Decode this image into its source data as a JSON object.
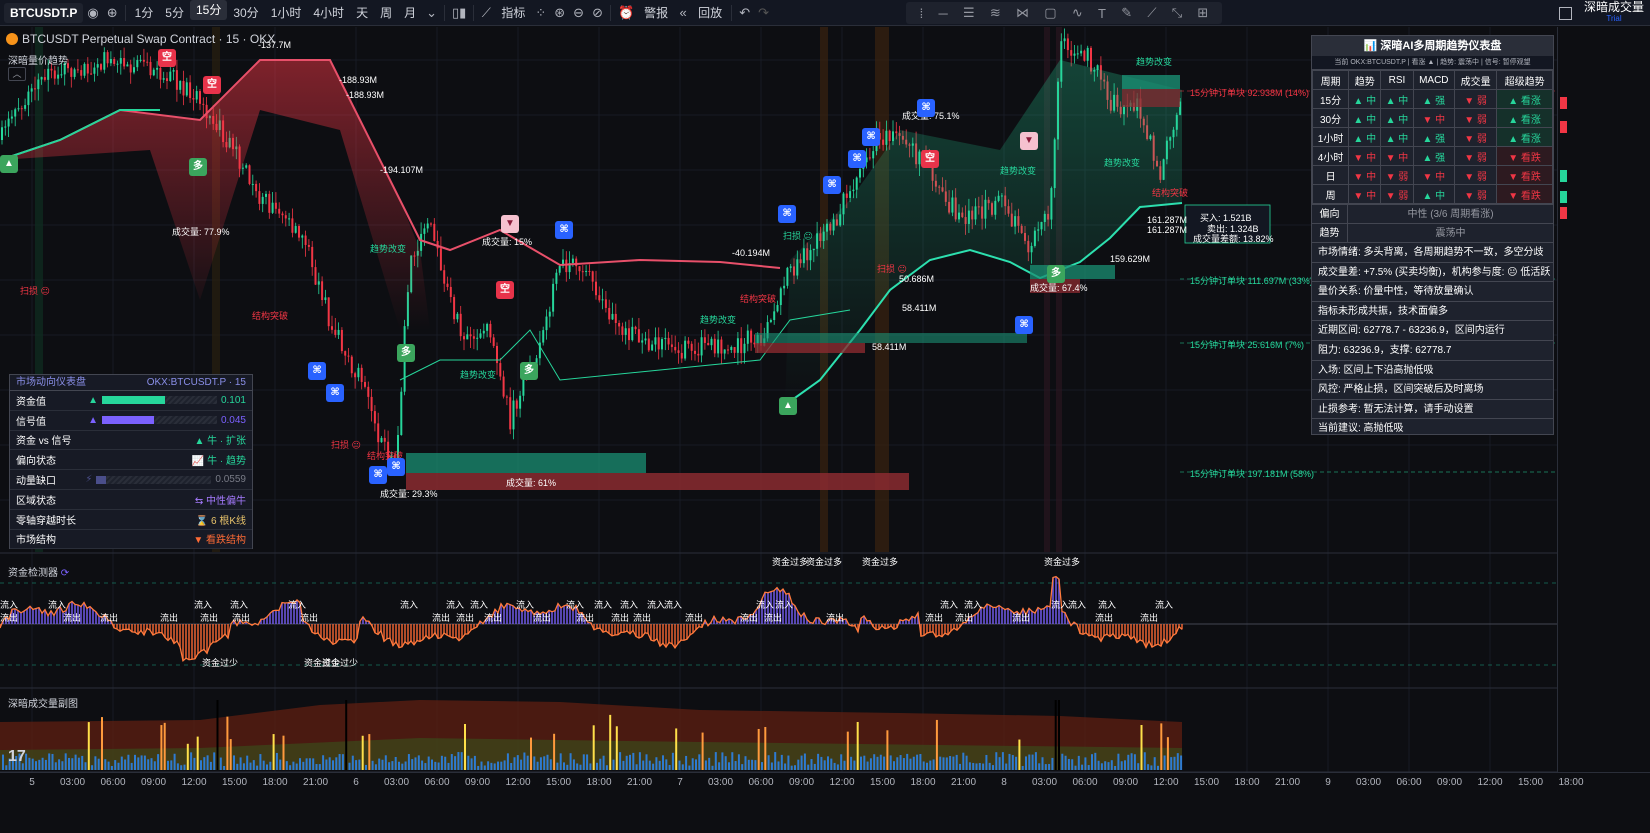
{
  "toolbar": {
    "symbol": "BTCUSDT.P",
    "intervals": [
      "1分",
      "5分",
      "15分",
      "30分",
      "1小时",
      "4小时",
      "天",
      "周",
      "月"
    ],
    "active_interval": "15分",
    "indicators": "指标",
    "alert": "警报",
    "replay": "回放"
  },
  "account": {
    "name": "深暗成交量",
    "tag": "Trial"
  },
  "chart_title": "BTCUSDT Perpetual Swap Contract · 15 · OKX",
  "indicator_name": "深暗量价趋势",
  "chart_labels": {
    "vol_pct": [
      "成交量: 77.9%",
      "成交量: 15%",
      "成交量: 75.1%",
      "成交量: 29.3%",
      "成交量: 61%",
      "成交量: 67.4%"
    ],
    "trend_change": "趋势改变",
    "structure_break": "结构突破",
    "scan": "扫损",
    "buy_box": [
      "买入: 1.521B",
      "卖出: 1.324B",
      "成交量差额: 13.82%"
    ],
    "orders": [
      "15分钟订单块 92.938M (14%)",
      "15分钟订单块 111.697M (33%)",
      "15分钟订单块 25.616M (7%)",
      "15分钟订单块 197.181M (58%)"
    ],
    "vol_small": [
      "-137.7M",
      "-188.93M",
      "-188.93M",
      "-194.107M",
      "-40.194M",
      "50.686M",
      "58.411M",
      "58.411M",
      "161.287M",
      "161.287M",
      "159.629M"
    ]
  },
  "mtf": {
    "title": "深暗AI多周期趋势仪表盘",
    "subtitle": "当前 OKX:BTCUSDT.P | 看涨 ▲ | 趋势: 震荡中 | 信号: 暂停观望",
    "headers": [
      "周期",
      "趋势",
      "RSI",
      "MACD",
      "成交量",
      "超级趋势"
    ],
    "rows": [
      [
        "15分",
        "▲ 中",
        "▲ 中",
        "▲ 强",
        "▼ 弱",
        "▲ 看涨"
      ],
      [
        "30分",
        "▲ 中",
        "▲ 中",
        "▼ 中",
        "▼ 弱",
        "▲ 看涨"
      ],
      [
        "1小时",
        "▲ 中",
        "▲ 中",
        "▲ 强",
        "▼ 弱",
        "▲ 看涨"
      ],
      [
        "4小时",
        "▼ 中",
        "▼ 中",
        "▲ 强",
        "▼ 弱",
        "▼ 看跌"
      ],
      [
        "日",
        "▼ 中",
        "▼ 弱",
        "▼ 中",
        "▼ 弱",
        "▼ 看跌"
      ],
      [
        "周",
        "▼ 中",
        "▼ 弱",
        "▲ 中",
        "▼ 弱",
        "▼ 看跌"
      ]
    ],
    "bias_label": "偏向",
    "bias_value": "中性 (3/6 周期看涨)",
    "trend_label": "趋势",
    "trend_value": "震荡中",
    "notes": [
      "市场情绪: 多头背离，各周期趋势不一致，多空分歧",
      "成交量差: +7.5% (买卖均衡)，机构参与度: 😐 低活跃",
      "量价关系: 价量中性，等待放量确认",
      "指标未形成共振，技术面偏多",
      "近期区间: 62778.7 - 63236.9，区间内运行",
      "阻力: 63236.9，支撑: 62778.7",
      "入场: 区间上下沿高抛低吸",
      "风控: 严格止损，区间突破后及时离场",
      "止损参考: 暂无法计算，请手动设置",
      "当前建议: 高抛低吸"
    ]
  },
  "dash": {
    "title": "市场动向仪表盘",
    "symbol": "OKX:BTCUSDT.P · 15",
    "rows": [
      {
        "k": "资金值",
        "v": "0.101",
        "fill": 0.55,
        "color": "#26d69b"
      },
      {
        "k": "信号值",
        "v": "0.045",
        "fill": 0.45,
        "color": "#7b61ff"
      },
      {
        "k": "资金 vs 信号",
        "v": "▲ 牛 · 扩张"
      },
      {
        "k": "偏向状态",
        "v": "📈 牛 · 趋势"
      },
      {
        "k": "动量缺口",
        "v": "0.0559",
        "fill": 0.08,
        "color": "#4a4e8a"
      },
      {
        "k": "区域状态",
        "v": "⇆ 中性偏牛"
      },
      {
        "k": "零轴穿越时长",
        "v": "⌛ 6 根K线"
      },
      {
        "k": "市场结构",
        "v": "▼ 看跌结构"
      }
    ]
  },
  "flow_name": "资金检测器",
  "flow_labels": {
    "in": "流入",
    "out": "流出",
    "over": "资金过多",
    "under": "资金过少"
  },
  "volume_name": "深暗成交量副图",
  "tv_logo": "17",
  "time_ticks": [
    "5",
    "03:00",
    "06:00",
    "09:00",
    "12:00",
    "15:00",
    "18:00",
    "21:00",
    "6",
    "03:00",
    "06:00",
    "09:00",
    "12:00",
    "15:00",
    "18:00",
    "21:00",
    "7",
    "03:00",
    "06:00",
    "09:00",
    "12:00",
    "15:00",
    "18:00",
    "21:00",
    "8",
    "03:00",
    "06:00",
    "09:00",
    "12:00",
    "15:00",
    "18:00",
    "21:00",
    "9",
    "03:00",
    "06:00",
    "09:00",
    "12:00",
    "15:00",
    "18:00"
  ],
  "colors": {
    "up": "#26d69b",
    "down": "#f23645",
    "accent": "#2962ff",
    "purple": "#7b61ff"
  }
}
